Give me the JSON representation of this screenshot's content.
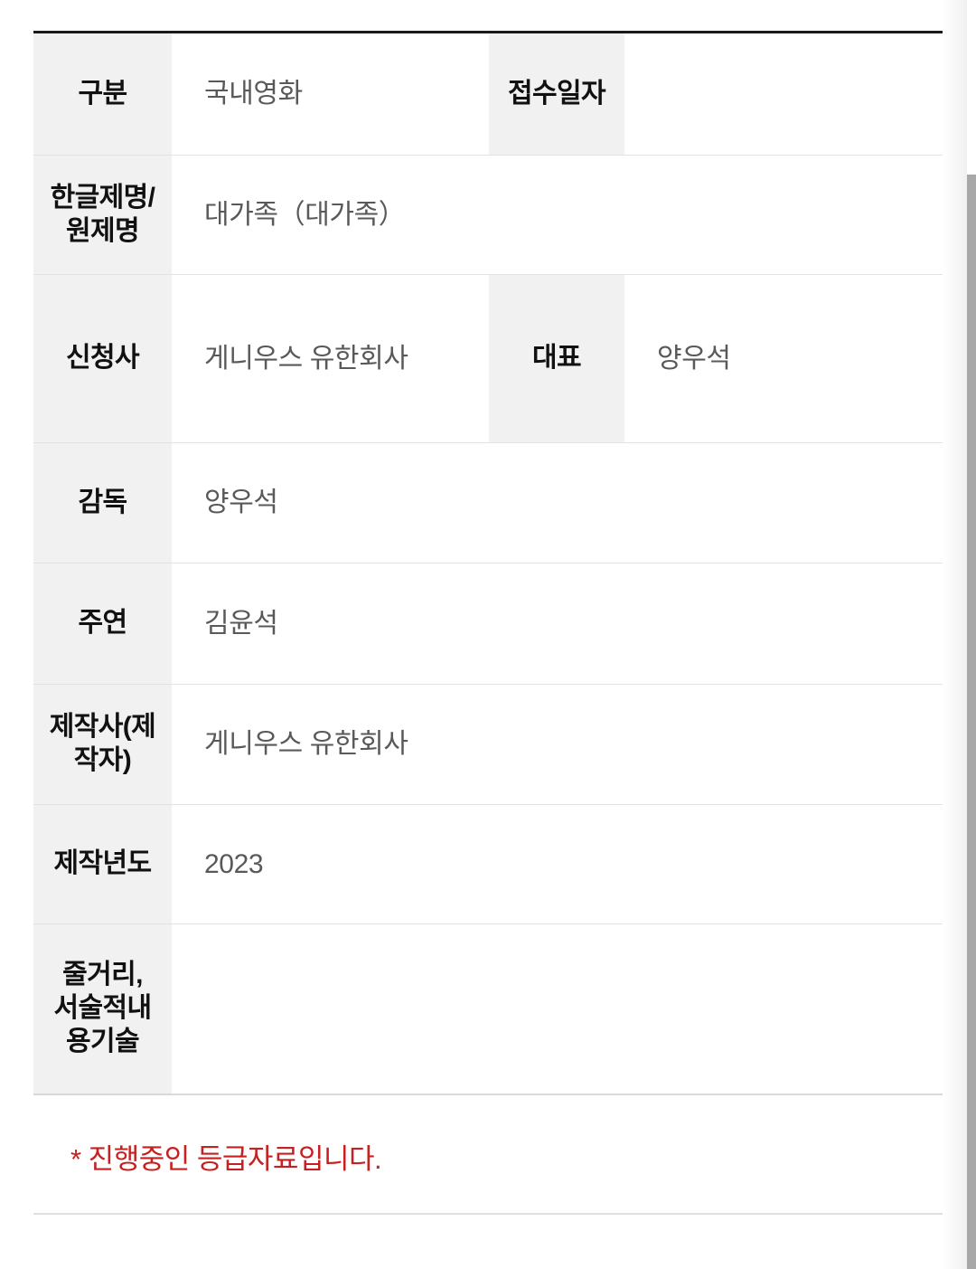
{
  "table": {
    "rows": [
      {
        "label": "구분",
        "value": "국내영화",
        "sub_label": "접수일자",
        "sub_value": ""
      },
      {
        "label": "한글제명/\n원제명",
        "label_line1": "한글제명/",
        "label_line2": "원제명",
        "value": "대가족（대가족）"
      },
      {
        "label": "신청사",
        "value": "게니우스 유한회사",
        "sub_label": "대표",
        "sub_value": "양우석"
      },
      {
        "label": "감독",
        "value": "양우석"
      },
      {
        "label": "주연",
        "value": "김윤석"
      },
      {
        "label": "제작사(제작자)",
        "label_line1": "제작사(제",
        "label_line2": "작자)",
        "value": "게니우스 유한회사"
      },
      {
        "label": "제작년도",
        "value": "2023"
      },
      {
        "label": "줄거리, 서술적내용기술",
        "label_line1": "줄거리,",
        "label_line2": "서술적내",
        "label_line3": "용기술",
        "value": ""
      }
    ]
  },
  "footer": {
    "note": "* 진행중인 등급자료입니다."
  },
  "colors": {
    "label_background": "#f1f1f1",
    "label_text": "#111111",
    "value_text": "#595959",
    "note_text": "#c62020",
    "top_border": "#1a1a1a",
    "row_border": "#e2e2e2",
    "scrollbar_thumb": "#a8a8a8"
  }
}
